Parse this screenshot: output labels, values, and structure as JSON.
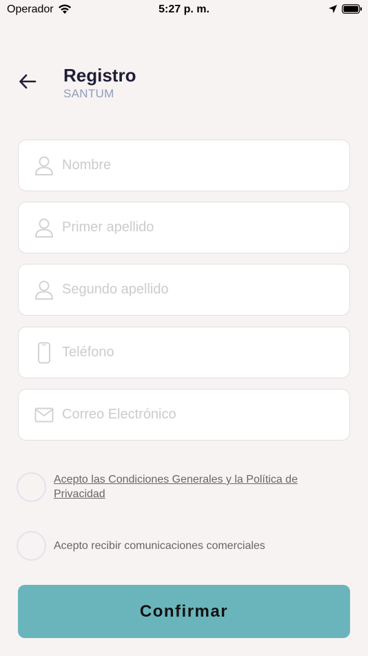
{
  "status_bar": {
    "carrier": "Operador",
    "time": "5:27 p. m.",
    "icons": [
      "wifi-icon",
      "location-arrow-icon",
      "battery-icon"
    ]
  },
  "header": {
    "back_icon": "arrow-left-icon",
    "title": "Registro",
    "subtitle": "SANTUM"
  },
  "form": {
    "fields": [
      {
        "name": "nombre",
        "icon": "person-icon",
        "placeholder": "Nombre",
        "value": ""
      },
      {
        "name": "primer-apellido",
        "icon": "person-icon",
        "placeholder": "Primer apellido",
        "value": ""
      },
      {
        "name": "segundo-apellido",
        "icon": "person-icon",
        "placeholder": "Segundo apellido",
        "value": ""
      },
      {
        "name": "telefono",
        "icon": "phone-icon",
        "placeholder": "Teléfono",
        "value": ""
      },
      {
        "name": "correo",
        "icon": "mail-icon",
        "placeholder": "Correo Electrónico",
        "value": ""
      }
    ]
  },
  "consents": {
    "terms_label": "Acepto las Condiciones Generales y la Política de Privacidad",
    "terms_checked": false,
    "marketing_label": "Acepto recibir comunicaciones comerciales",
    "marketing_checked": false
  },
  "actions": {
    "confirm_label": "Confirmar"
  },
  "colors": {
    "background": "#f7f3f2",
    "title": "#1f1d36",
    "subtitle": "#8f9cbd",
    "button": "#6ab5bb",
    "placeholder": "#cdcbcc"
  }
}
